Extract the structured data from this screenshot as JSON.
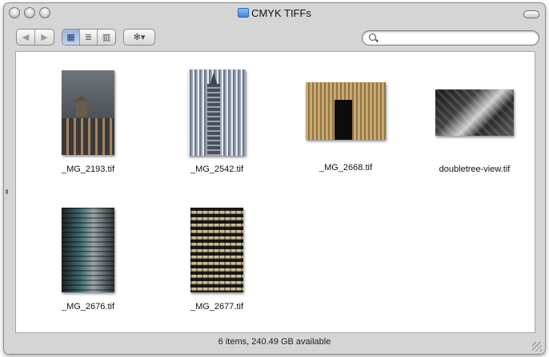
{
  "window": {
    "title": "CMYK TIFFs"
  },
  "toolbar": {
    "back_glyph": "◀",
    "forward_glyph": "▶",
    "view_icon_glyph": "▦",
    "view_list_glyph": "≣",
    "view_column_glyph": "▥",
    "action_glyph": "✻▾",
    "search": {
      "value": "",
      "placeholder": ""
    }
  },
  "files": [
    {
      "name": "_MG_2193.tif",
      "icon": "tiff-thumbnail"
    },
    {
      "name": "_MG_2542.tif",
      "icon": "tiff-thumbnail"
    },
    {
      "name": "_MG_2668.tif",
      "icon": "tiff-thumbnail"
    },
    {
      "name": "doubletree-view.tif",
      "icon": "tiff-thumbnail"
    },
    {
      "name": "_MG_2676.tif",
      "icon": "tiff-thumbnail"
    },
    {
      "name": "_MG_2677.tif",
      "icon": "tiff-thumbnail"
    }
  ],
  "status": {
    "text": "6 items, 240.49 GB available"
  },
  "colors": {
    "selected_view": "#9cb4d6",
    "folder_icon": "#3b86d8"
  }
}
